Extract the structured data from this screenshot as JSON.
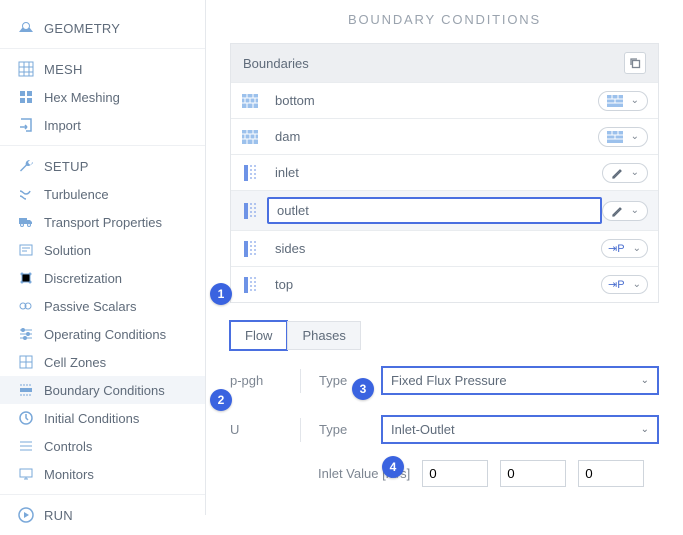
{
  "page": {
    "title": "BOUNDARY CONDITIONS"
  },
  "sidebar": {
    "geometry": {
      "label": "GEOMETRY"
    },
    "mesh": {
      "label": "MESH",
      "hex": "Hex Meshing",
      "import": "Import"
    },
    "setup": {
      "label": "SETUP",
      "items": [
        "Turbulence",
        "Transport Properties",
        "Solution",
        "Discretization",
        "Passive Scalars",
        "Operating Conditions",
        "Cell Zones",
        "Boundary Conditions",
        "Initial Conditions",
        "Controls",
        "Monitors"
      ]
    },
    "run": {
      "label": "RUN"
    }
  },
  "boundaries": {
    "header": "Boundaries",
    "rows": [
      {
        "name": "bottom",
        "type": "wall"
      },
      {
        "name": "dam",
        "type": "wall"
      },
      {
        "name": "inlet",
        "type": "patch-pencil"
      },
      {
        "name": "outlet",
        "type": "patch-pencil"
      },
      {
        "name": "sides",
        "type": "patch-p"
      },
      {
        "name": "top",
        "type": "patch-p"
      }
    ]
  },
  "tabs": {
    "flow": "Flow",
    "phases": "Phases"
  },
  "form": {
    "p_pgh": {
      "field": "p-pgh",
      "type_label": "Type",
      "type_value": "Fixed Flux Pressure"
    },
    "U": {
      "field": "U",
      "type_label": "Type",
      "type_value": "Inlet-Outlet",
      "inlet_label": "Inlet Value [m/s]",
      "vx": "0",
      "vy": "0",
      "vz": "0"
    }
  },
  "callouts": {
    "c1": "1",
    "c2": "2",
    "c3": "3",
    "c4": "4"
  }
}
